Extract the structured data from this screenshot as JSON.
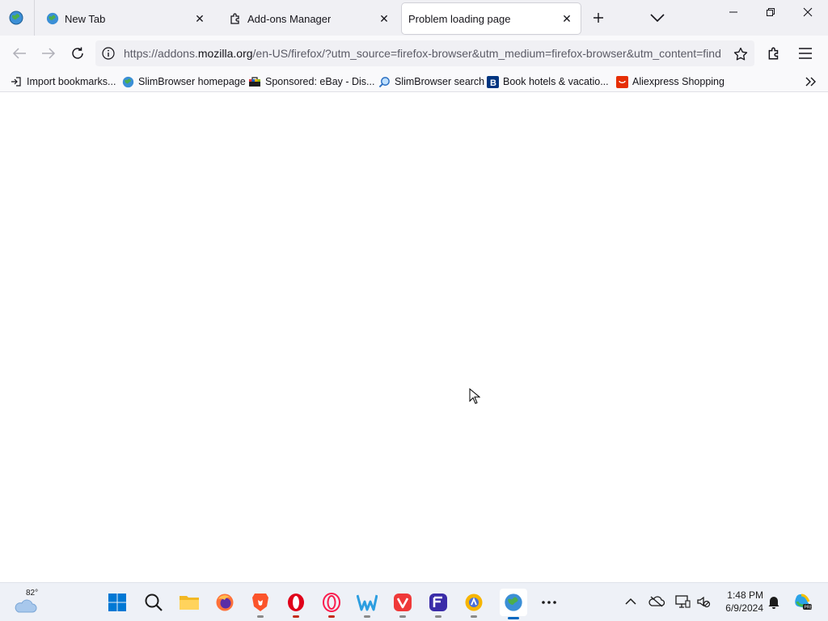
{
  "tabs": [
    {
      "title": "New Tab",
      "active": false
    },
    {
      "title": "Add-ons Manager",
      "active": false
    },
    {
      "title": "Problem loading page",
      "active": true
    }
  ],
  "urlbar": {
    "url_prefix": "https://addons.",
    "url_host": "mozilla.org",
    "url_rest": "/en-US/firefox/?utm_source=firefox-browser&utm_medium=firefox-browser&utm_content=find"
  },
  "bookmarks": [
    {
      "label": "Import bookmarks...",
      "icon": "import-icon"
    },
    {
      "label": "SlimBrowser homepage",
      "icon": "globe-icon"
    },
    {
      "label": "Sponsored: eBay - Dis...",
      "icon": "ebay-icon"
    },
    {
      "label": "SlimBrowser search",
      "icon": "search-icon"
    },
    {
      "label": "Book hotels & vacatio...",
      "icon": "booking-icon"
    },
    {
      "label": "Aliexpress Shopping",
      "icon": "aliexpress-icon"
    }
  ],
  "taskbar": {
    "weather_temp": "82°",
    "clock_time": "1:48 PM",
    "clock_date": "6/9/2024",
    "apps": [
      "start",
      "search",
      "file-explorer",
      "firefox",
      "brave",
      "opera",
      "opera-gx",
      "waterfox",
      "vivaldi",
      "floorp",
      "maxthon",
      "slimbrowser",
      "more"
    ]
  },
  "colors": {
    "tabstrip_bg": "#f0f0f4",
    "accent_blue": "#0067c0"
  }
}
